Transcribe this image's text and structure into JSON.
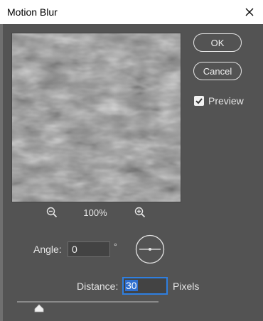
{
  "dialog": {
    "title": "Motion Blur"
  },
  "buttons": {
    "ok": "OK",
    "cancel": "Cancel"
  },
  "preview": {
    "label": "Preview",
    "checked": true
  },
  "zoom": {
    "level": "100%",
    "zoom_out_icon": "zoom-out-icon",
    "zoom_in_icon": "zoom-in-icon"
  },
  "angle": {
    "label": "Angle:",
    "value": "0",
    "unit": "°",
    "dial_icon": "angle-dial"
  },
  "distance": {
    "label": "Distance:",
    "value": "30",
    "unit": "Pixels"
  },
  "colors": {
    "background": "#535353",
    "accent": "#2f7fe0"
  }
}
